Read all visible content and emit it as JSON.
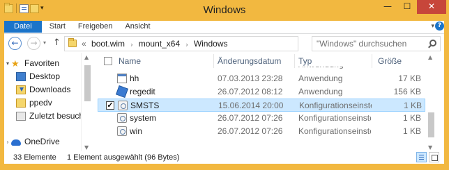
{
  "window": {
    "title": "Windows",
    "minimize": "—",
    "maximize": "☐",
    "close": "✕",
    "accent_color": "#f2b840"
  },
  "ribbon": {
    "tabs": [
      "Datei",
      "Start",
      "Freigeben",
      "Ansicht"
    ],
    "help": "?"
  },
  "navigation": {
    "back": "←",
    "forward": "→",
    "up": "↑",
    "path_prefix": "«",
    "path": [
      "boot.wim",
      "mount_x64",
      "Windows"
    ],
    "search_placeholder": "\"Windows\" durchsuchen"
  },
  "sidebar": {
    "items": [
      {
        "label": "Favoriten",
        "icon": "star-icon"
      },
      {
        "label": "Desktop",
        "icon": "desktop-icon"
      },
      {
        "label": "Downloads",
        "icon": "downloads-icon"
      },
      {
        "label": "ppedv",
        "icon": "folder-icon"
      },
      {
        "label": "Zuletzt besucht",
        "icon": "recent-places-icon"
      },
      {
        "label": "OneDrive",
        "icon": "onedrive-icon"
      }
    ]
  },
  "filelist": {
    "columns": [
      "Name",
      "Änderungsdatum",
      "Typ",
      "Größe"
    ],
    "partial_row_type": "Anwendung",
    "rows": [
      {
        "name": "hh",
        "date": "07.03.2013 23:28",
        "type": "Anwendung",
        "size": "17 KB",
        "icon": "application-icon",
        "selected": false
      },
      {
        "name": "regedit",
        "date": "26.07.2012 08:12",
        "type": "Anwendung",
        "size": "156 KB",
        "icon": "regedit-icon",
        "selected": false
      },
      {
        "name": "SMSTS",
        "date": "15.06.2014 20:00",
        "type": "Konfigurationseinste...",
        "size": "1 KB",
        "icon": "config-file-icon",
        "selected": true
      },
      {
        "name": "system",
        "date": "26.07.2012 07:26",
        "type": "Konfigurationseinste...",
        "size": "1 KB",
        "icon": "config-file-icon",
        "selected": false
      },
      {
        "name": "win",
        "date": "26.07.2012 07:26",
        "type": "Konfigurationseinste...",
        "size": "1 KB",
        "icon": "config-file-icon",
        "selected": false
      }
    ]
  },
  "status": {
    "count": "33 Elemente",
    "selected": "1 Element ausgewählt (96 Bytes)"
  }
}
